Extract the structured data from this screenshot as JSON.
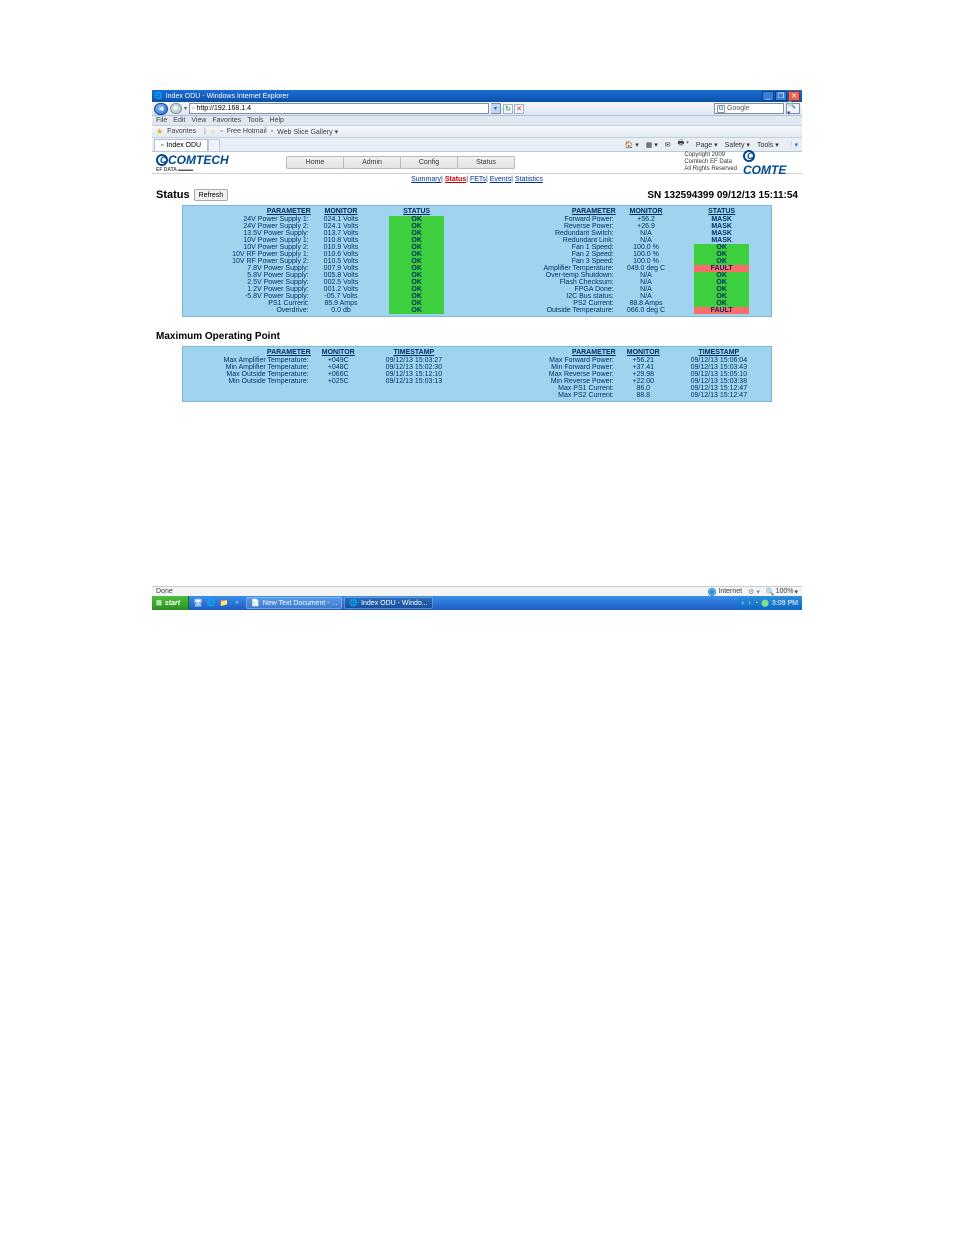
{
  "window": {
    "title": "Index ODU - Windows Internet Explorer"
  },
  "address_bar": {
    "url": "http://192.168.1.4"
  },
  "search": {
    "provider": "Google"
  },
  "menu": {
    "file": "File",
    "edit": "Edit",
    "view": "View",
    "favorites": "Favorites",
    "tools": "Tools",
    "help": "Help"
  },
  "favbar": {
    "label": "Favorites",
    "item1": "Free Hotmail",
    "item2": "Web Slice Gallery ▾"
  },
  "tab": {
    "title": "Index ODU"
  },
  "tabtools": {
    "page": "Page ▾",
    "safety": "Safety ▾",
    "tools": "Tools ▾"
  },
  "header": {
    "logo": "COMTECH",
    "logosub": "EF DATA ▬▬▬",
    "nav": {
      "home": "Home",
      "admin": "Admin",
      "config": "Config",
      "status": "Status"
    },
    "copyright": {
      "l1": "Copyright 2009",
      "l2": "Comtech EF Data",
      "l3": "All Rights Reserved"
    },
    "logoright": "COMTE"
  },
  "subnav": {
    "summary": "Summary",
    "status": "Status",
    "fets": "FETs",
    "events": "Events",
    "statistics": "Statistics"
  },
  "status_section": {
    "label": "Status",
    "refresh": "Refresh",
    "sn": "SN 132594399 09/12/13 15:11:54"
  },
  "tbl_headers": {
    "parameter": "PARAMETER",
    "monitor": "MONITOR",
    "status": "STATUS",
    "timestamp": "TIMESTAMP"
  },
  "status_left": [
    {
      "p": "24V Power Supply 1:",
      "m": "024.1 Volts",
      "s": "OK",
      "c": "ok"
    },
    {
      "p": "24V Power Supply 2:",
      "m": "024.1 Volts",
      "s": "OK",
      "c": "ok"
    },
    {
      "p": "13.5V Power Supply:",
      "m": "013.7 Volts",
      "s": "OK",
      "c": "ok"
    },
    {
      "p": "10V Power Supply 1:",
      "m": "010.8 Volts",
      "s": "OK",
      "c": "ok"
    },
    {
      "p": "10V Power Supply 2:",
      "m": "010.9 Volts",
      "s": "OK",
      "c": "ok"
    },
    {
      "p": "10V RF Power Supply 1:",
      "m": "010.6 Volts",
      "s": "OK",
      "c": "ok"
    },
    {
      "p": "10V RF Power Supply 2:",
      "m": "010.5 Volts",
      "s": "OK",
      "c": "ok"
    },
    {
      "p": "7.8V Power Supply:",
      "m": "007.9 Volts",
      "s": "OK",
      "c": "ok"
    },
    {
      "p": "5.8V Power Supply:",
      "m": "005.8 Volts",
      "s": "OK",
      "c": "ok"
    },
    {
      "p": "2.5V Power Supply:",
      "m": "002.5 Volts",
      "s": "OK",
      "c": "ok"
    },
    {
      "p": "1.2V Power Supply:",
      "m": "001.2 Volts",
      "s": "OK",
      "c": "ok"
    },
    {
      "p": "-5.8V Power Supply:",
      "m": "-05.7 Volts",
      "s": "OK",
      "c": "ok"
    },
    {
      "p": "PS1 Current:",
      "m": "85.9 Amps",
      "s": "OK",
      "c": "ok"
    },
    {
      "p": "Overdrive:",
      "m": "0.0 db",
      "s": "OK",
      "c": "ok"
    }
  ],
  "status_right": [
    {
      "p": "Forward Power:",
      "m": "+56.2",
      "s": "MASK",
      "c": "mask"
    },
    {
      "p": "Reverse Power:",
      "m": "+26.9",
      "s": "MASK",
      "c": "mask"
    },
    {
      "p": "Redundant Switch:",
      "m": "N/A",
      "s": "MASK",
      "c": "mask"
    },
    {
      "p": "Redundant Link:",
      "m": "N/A",
      "s": "MASK",
      "c": "mask"
    },
    {
      "p": "Fan 1 Speed:",
      "m": "100.0 %",
      "s": "OK",
      "c": "ok"
    },
    {
      "p": "Fan 2 Speed:",
      "m": "100.0 %",
      "s": "OK",
      "c": "ok"
    },
    {
      "p": "Fan 3 Speed:",
      "m": "100.0 %",
      "s": "OK",
      "c": "ok"
    },
    {
      "p": "Amplifier Temperature:",
      "m": "049.0 deg C",
      "s": "FAULT",
      "c": "fault"
    },
    {
      "p": "Over-temp Shutdown:",
      "m": "N/A",
      "s": "OK",
      "c": "ok"
    },
    {
      "p": "Flash Checksum:",
      "m": "N/A",
      "s": "OK",
      "c": "ok"
    },
    {
      "p": "FPGA Done:",
      "m": "N/A",
      "s": "OK",
      "c": "ok"
    },
    {
      "p": "I2C Bus status:",
      "m": "N/A",
      "s": "OK",
      "c": "ok"
    },
    {
      "p": "PS2 Current:",
      "m": "88.8 Amps",
      "s": "OK",
      "c": "ok"
    },
    {
      "p": "Outside Temperature:",
      "m": "066.0 deg C",
      "s": "FAULT",
      "c": "fault"
    }
  ],
  "mop": {
    "title": "Maximum Operating Point"
  },
  "mop_left": [
    {
      "p": "Max Amplifier Temperature:",
      "m": "+049C",
      "t": "09/12/13 15:03:27"
    },
    {
      "p": "Min Amplifier Temperature:",
      "m": "+048C",
      "t": "09/12/13 15:02:30"
    },
    {
      "p": "Max Outside Temperature:",
      "m": "+066C",
      "t": "09/12/13 15:12:10"
    },
    {
      "p": "Min Outside Temperature:",
      "m": "+025C",
      "t": "09/12/13 15:03:13"
    }
  ],
  "mop_right": [
    {
      "p": "Max Forward Power:",
      "m": "+56.21",
      "t": "09/12/13 15:06:04"
    },
    {
      "p": "Min Forward Power:",
      "m": "+37.41",
      "t": "09/12/13 15:03:43"
    },
    {
      "p": "Max Reverse Power:",
      "m": "+29.98",
      "t": "09/12/13 15:05:10"
    },
    {
      "p": "Min Reverse Power:",
      "m": "+22.00",
      "t": "09/12/13 15:03:38"
    },
    {
      "p": "Max PS1 Current:",
      "m": "86.0",
      "t": "09/12/13 15:12:47"
    },
    {
      "p": "Max PS2 Current:",
      "m": "88.8",
      "t": "09/12/13 15:12:47"
    }
  ],
  "ie_status": {
    "done": "Done",
    "zone": "Internet",
    "zoom": "100%"
  },
  "taskbar": {
    "start": "start",
    "btn1": "New Text Document - ...",
    "btn2": "Index ODU - Windo...",
    "clock": "3:09 PM"
  }
}
